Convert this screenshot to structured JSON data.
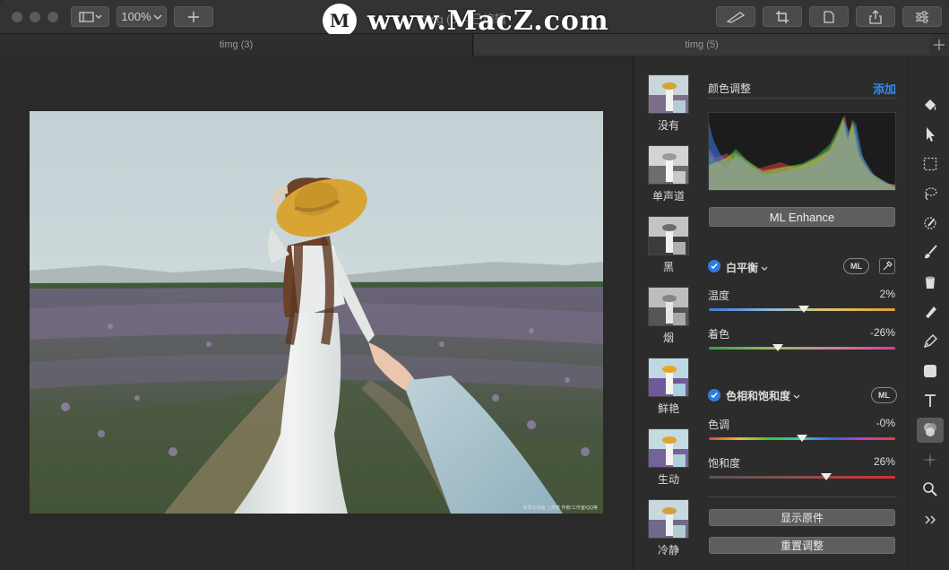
{
  "window": {
    "title": "timg (5) - 已编辑",
    "zoom": "100%"
  },
  "watermark": {
    "logo_letter": "M",
    "text": "www.MacZ.com"
  },
  "tabs": [
    {
      "label": "timg (3)",
      "active": false
    },
    {
      "label": "timg (5)",
      "active": true
    }
  ],
  "photo": {
    "credit": "浙风车插画 上传者 作者/工作室/QQ等"
  },
  "presets": [
    {
      "label": "没有"
    },
    {
      "label": "单声道"
    },
    {
      "label": "黑"
    },
    {
      "label": "烟"
    },
    {
      "label": "鲜艳"
    },
    {
      "label": "生动"
    },
    {
      "label": "冷静"
    }
  ],
  "adjust": {
    "section_title": "颜色调整",
    "add_label": "添加",
    "ml_enhance": "ML Enhance",
    "white_balance": {
      "title": "白平衡",
      "ml": "ML",
      "temperature_label": "温度",
      "temperature_value": "2%",
      "temperature": 0.51,
      "tint_label": "着色",
      "tint_value": "-26%",
      "tint": 0.37
    },
    "hue_sat": {
      "title": "色相和饱和度",
      "ml": "ML",
      "hue_label": "色调",
      "hue_value": "-0%",
      "hue": 0.5,
      "saturation_label": "饱和度",
      "saturation_value": "26%",
      "saturation": 0.63
    },
    "show_original": "显示原件",
    "reset": "重置调整"
  },
  "tools": [
    "paint-bucket-icon",
    "arrow-cursor-icon",
    "rect-select-icon",
    "lasso-icon",
    "magic-select-icon",
    "brush-icon",
    "eraser-icon",
    "smudge-icon",
    "pen-icon",
    "shape-icon",
    "text-icon",
    "color-adjust-icon",
    "effects-icon",
    "zoom-icon",
    "more-icon"
  ]
}
